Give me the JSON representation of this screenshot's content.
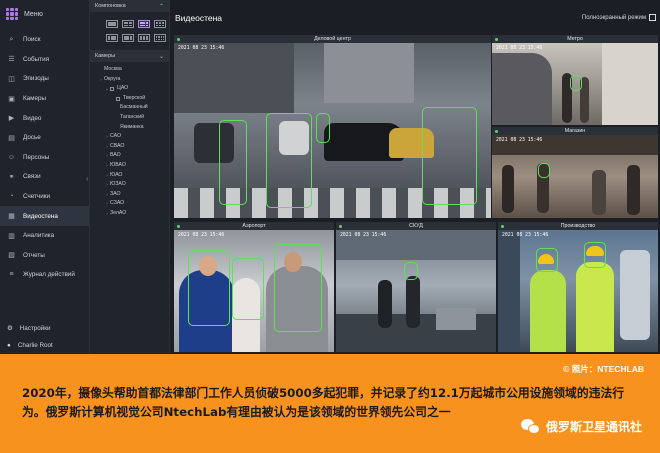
{
  "sidebar": {
    "menu_label": "Меню",
    "items": [
      {
        "label": "Поиск",
        "icon": "search-icon",
        "glyph": "⌕"
      },
      {
        "label": "События",
        "icon": "events-icon",
        "glyph": "☰"
      },
      {
        "label": "Эпизоды",
        "icon": "episodes-icon",
        "glyph": "◫"
      },
      {
        "label": "Камеры",
        "icon": "camera-icon",
        "glyph": "▣"
      },
      {
        "label": "Видео",
        "icon": "video-icon",
        "glyph": "▶"
      },
      {
        "label": "Досье",
        "icon": "dossier-icon",
        "glyph": "▤"
      },
      {
        "label": "Персоны",
        "icon": "persons-icon",
        "glyph": "☺"
      },
      {
        "label": "Связи",
        "icon": "links-icon",
        "glyph": "⚭"
      },
      {
        "label": "Счетчики",
        "icon": "counters-icon",
        "glyph": "◔"
      },
      {
        "label": "Видеостена",
        "icon": "videowall-icon",
        "glyph": "▦",
        "active": true
      },
      {
        "label": "Аналитика",
        "icon": "analytics-icon",
        "glyph": "▥"
      },
      {
        "label": "Отчеты",
        "icon": "reports-icon",
        "glyph": "▧"
      },
      {
        "label": "Журнал действий",
        "icon": "log-icon",
        "glyph": "≡"
      }
    ],
    "settings_label": "Настройки",
    "user_label": "Charlie Root"
  },
  "layout_panel": {
    "title": "Компоновка"
  },
  "cameras_panel": {
    "title": "Камеры",
    "tree": [
      {
        "label": "Москва",
        "level": 0,
        "toggle": ""
      },
      {
        "label": "Округа",
        "level": 0,
        "toggle": "›"
      },
      {
        "label": "ЦАО",
        "level": 1,
        "toggle": "⌄",
        "checkbox": true
      },
      {
        "label": "Тверской",
        "level": 2,
        "toggle": "",
        "checkbox": true
      },
      {
        "label": "Басманный",
        "level": 3,
        "toggle": ""
      },
      {
        "label": "Таганский",
        "level": 3,
        "toggle": ""
      },
      {
        "label": "Якиманка",
        "level": 3,
        "toggle": ""
      },
      {
        "label": "САО",
        "level": 1,
        "toggle": "›"
      },
      {
        "label": "СВАО",
        "level": 1,
        "toggle": "›"
      },
      {
        "label": "ВАО",
        "level": 1,
        "toggle": "›"
      },
      {
        "label": "ЮВАО",
        "level": 1,
        "toggle": "›"
      },
      {
        "label": "ЮАО",
        "level": 1,
        "toggle": "›"
      },
      {
        "label": "ЮЗАО",
        "level": 1,
        "toggle": "›"
      },
      {
        "label": "ЗАО",
        "level": 1,
        "toggle": "›"
      },
      {
        "label": "СЗАО",
        "level": 1,
        "toggle": "›"
      },
      {
        "label": "ЗелАО",
        "level": 1,
        "toggle": "›"
      }
    ]
  },
  "main": {
    "title": "Видеостена",
    "fullscreen_label": "Полноэкранный режим",
    "tiles": [
      {
        "name": "Деловой центр",
        "time": "2021 08 23 15:46"
      },
      {
        "name": "Метро",
        "time": "2021 08 23 15:46"
      },
      {
        "name": "Магазин",
        "time": "2021 08 23 15:46"
      },
      {
        "name": "Аэропорт",
        "time": "2021 08 23 15:46"
      },
      {
        "name": "СКУД",
        "time": "2021 08 23 15:46"
      },
      {
        "name": "Производство",
        "time": "2021 08 23 15:46"
      }
    ]
  },
  "caption": {
    "credit": "© 照片：NTECHLAB",
    "text": "2020年，摄像头帮助首都法律部门工作人员侦破5000多起犯罪，并记录了约12.1万起城市公用设施领域的违法行为。俄罗斯计算机视觉公司NtechLab有理由被认为是该领域的世界领先公司之一",
    "watermark": "俄罗斯卫星通讯社"
  },
  "colors": {
    "accent": "#b07ae0",
    "detection": "#5ee05a",
    "caption_bg": "#f7921e"
  }
}
